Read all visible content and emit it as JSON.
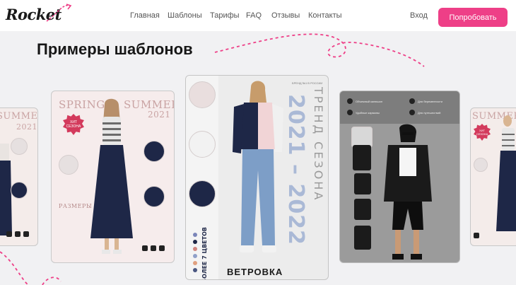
{
  "brand": {
    "logo_text": "Rocket"
  },
  "nav": {
    "items": [
      {
        "label": "Главная"
      },
      {
        "label": "Шаблоны"
      },
      {
        "label": "Тарифы"
      },
      {
        "label": "FAQ"
      },
      {
        "label": "Отзывы"
      },
      {
        "label": "Контакты"
      }
    ],
    "login_label": "Вход",
    "cta_label": "Попробовать"
  },
  "section": {
    "title": "Примеры шаблонов"
  },
  "colors": {
    "accent": "#ee3f87",
    "background": "#f1f1f3",
    "navy": "#1e2747"
  },
  "cards": [
    {
      "season_text": "SUMMER",
      "year_text": "2021"
    },
    {
      "season_left": "SPRING",
      "season_right": "SUMMER",
      "year": "2021",
      "badge_text": "ХИТ СЕЗОНА",
      "sizes_title": "РАЗМЕРЫ"
    },
    {
      "brand_line": "БРЕНД №1 В РОССИИ",
      "headline_vertical": "ТРЕНД СЕЗОНА",
      "year_range": "2021 – 2022",
      "colors_note": "БОЛЕЕ 7 ЦВЕТОВ",
      "product_name": "ВЕТРОВКА"
    },
    {
      "features": [
        "Объемный капюшон",
        "Для беременности",
        "Удобные карманы",
        "Для путешествий"
      ]
    },
    {
      "season_text": "SUMMER",
      "badge_text": "ХИТ СЕЗОНА"
    }
  ]
}
